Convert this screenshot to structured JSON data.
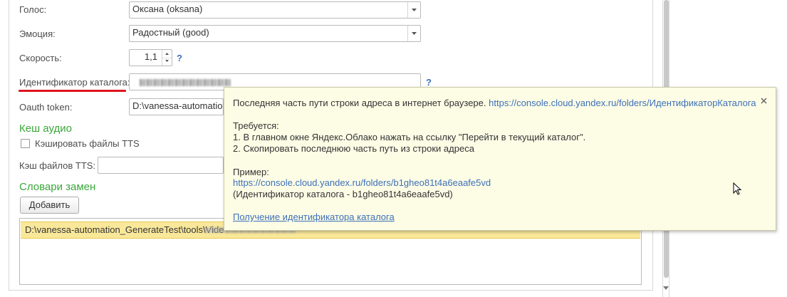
{
  "form": {
    "voice": {
      "label": "Голос:",
      "value": "Оксана (oksana)"
    },
    "emotion": {
      "label": "Эмоция:",
      "value": "Радостный (good)"
    },
    "speed": {
      "label": "Скорость:",
      "value": "1,1",
      "help": "?"
    },
    "catalog_id": {
      "label": "Идентификатор каталога:",
      "value": "",
      "help": "?"
    },
    "oauth": {
      "label": "Oauth token:",
      "value": "D:\\vanessa-automation"
    },
    "audio_cache_section": "Кеш аудио",
    "cache_checkbox": {
      "label": "Кэшировать файлы TTS",
      "checked": false
    },
    "cache_files": {
      "label": "Кэш файлов TTS:",
      "value": ""
    },
    "dict_section": "Словари замен",
    "add_button": "Добавить",
    "dict_list": [
      "D:\\vanessa-automation_GenerateTest\\tools\\Vide"
    ]
  },
  "tooltip": {
    "line1": "Последняя часть пути строки адреса в интернет браузере.",
    "url1": "https://console.cloud.yandex.ru/folders/ИдентификаторКаталога",
    "required_title": "Требуется:",
    "step1": "1. В главном окне Яндекс.Облако нажать на ссылку \"Перейти в текущий каталог\".",
    "step2": "2. Скопировать последнюю часть путь из строки адреса",
    "example_title": "Пример:",
    "example_url": "https://console.cloud.yandex.ru/folders/b1gheo81t4a6eaafe5vd",
    "example_note": "(Идентификатор каталога - b1gheo81t4a6eaafe5vd)",
    "help_link": "Получение идентификатора каталога",
    "close_icon": "close-icon"
  },
  "colors": {
    "section_green": "#3aa63a",
    "link_blue": "#3d6fb8",
    "tooltip_bg": "#fdfde6",
    "selected_row": "#fae89a",
    "highlight_underline": "#e0141e"
  }
}
